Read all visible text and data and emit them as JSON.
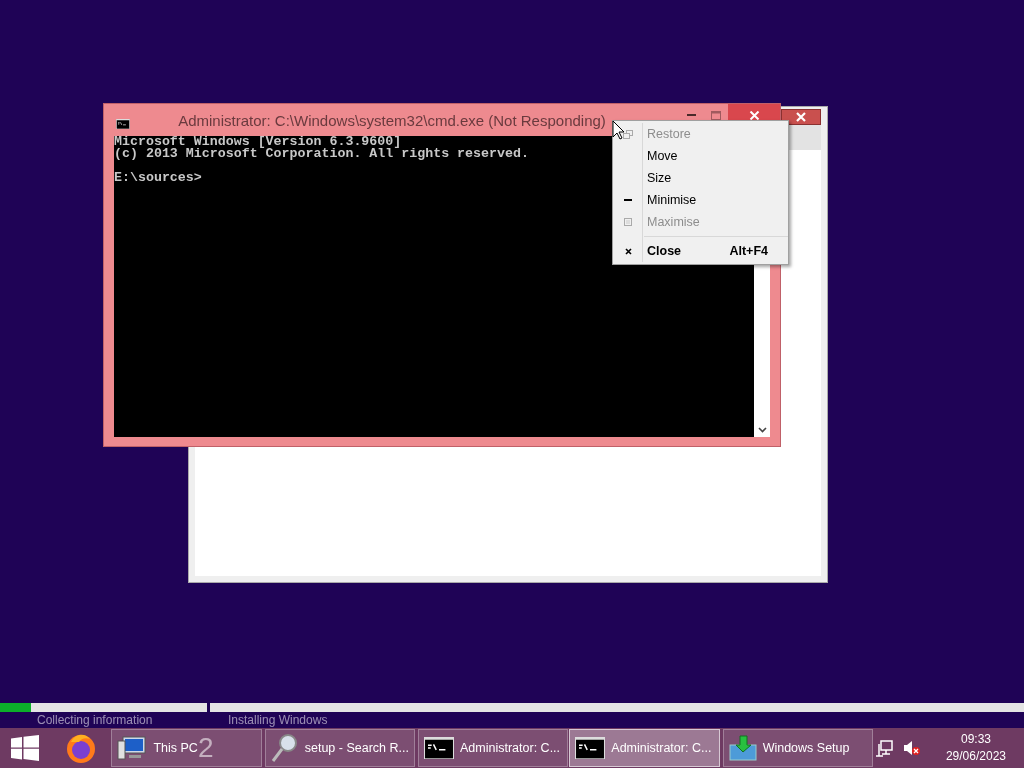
{
  "cmd_window": {
    "title": "Administrator: C:\\Windows\\system32\\cmd.exe (Not Responding)",
    "console": {
      "banner": [
        "Microsoft Windows [Version 6.3.9600]",
        "(c) 2013 Microsoft Corporation. All rights reserved."
      ],
      "prompt": "E:\\sources>"
    },
    "menu": [
      {
        "label": "Restore",
        "disabled": true
      },
      {
        "label": "Move",
        "disabled": false
      },
      {
        "label": "Size",
        "disabled": false
      },
      {
        "label": "Minimise",
        "disabled": false
      },
      {
        "label": "Maximise",
        "disabled": true
      },
      {
        "label": "Close",
        "disabled": false,
        "shortcut": "Alt+F4"
      }
    ]
  },
  "setup_progress": [
    {
      "label": "Collecting information",
      "level": 0.15
    },
    {
      "label": "Installing Windows",
      "level": 0
    }
  ],
  "taskbar": {
    "buttons": [
      {
        "label": "This PC",
        "badge": "2",
        "selected": false
      },
      {
        "label": "setup - Search R...",
        "selected": false
      },
      {
        "label": "Administrator: C...",
        "selected": false
      },
      {
        "label": "Administrator: C...",
        "selected": true
      },
      {
        "label": "Windows Setup",
        "selected": false
      }
    ],
    "clock": {
      "time": "09:33",
      "date": "29/06/2023"
    }
  }
}
